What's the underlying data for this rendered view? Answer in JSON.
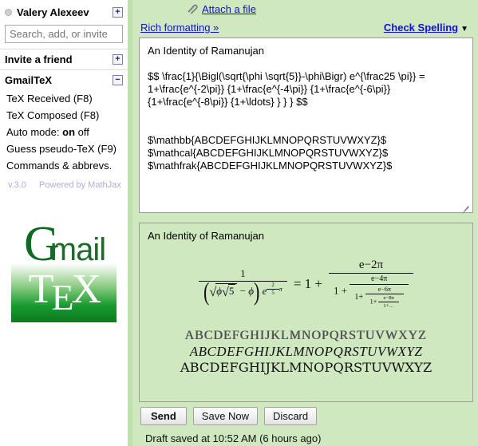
{
  "sidebar": {
    "chat": {
      "user_name": "Valery Alexeev",
      "expand_label": "+",
      "status_icon": "offline-status-icon"
    },
    "search": {
      "placeholder": "Search, add, or invite",
      "value": ""
    },
    "invite": {
      "label": "Invite a friend",
      "expand_label": "+"
    },
    "gmailtex": {
      "title": "GmailTeX",
      "collapse_label": "−",
      "items": [
        {
          "label": "TeX Received (F8)",
          "name": "tex-received"
        },
        {
          "label": "TeX Composed (F8)",
          "name": "tex-composed"
        },
        {
          "label": "Guess pseudo-TeX (F9)",
          "name": "guess-pseudo-tex"
        },
        {
          "label": "Commands & abbrevs.",
          "name": "commands-abbrevs"
        }
      ],
      "auto_mode": {
        "label": "Auto mode:",
        "on": "on",
        "off": "off"
      },
      "version": "v.3.0",
      "powered_by": "Powered by MathJax"
    },
    "logo": {
      "g": "G",
      "mail": "mail",
      "t": "T",
      "e": "E",
      "x": "X"
    }
  },
  "compose": {
    "attach_label": "Attach a file",
    "rich_formatting_label": "Rich formatting »",
    "check_spelling_label": "Check Spelling",
    "check_spelling_caret": "▼",
    "body_value": "An Identity of Ramanujan\n\n$$ \\frac{1}{\\Bigl(\\sqrt{\\phi \\sqrt{5}}-\\phi\\Bigr) e^{\\frac25 \\pi}} =\n1+\\frac{e^{-2\\pi}} {1+\\frac{e^{-4\\pi}} {1+\\frac{e^{-6\\pi}}\n{1+\\frac{e^{-8\\pi}} {1+\\ldots} } } } $$\n\n\n$\\mathbb{ABCDEFGHIJKLMNOPQRSTUVWXYZ}$\n$\\mathcal{ABCDEFGHIJKLMNOPQRSTUVWXYZ}$\n$\\mathfrak{ABCDEFGHIJKLMNOPQRSTUVWXYZ}$",
    "buttons": {
      "send": "Send",
      "save_now": "Save Now",
      "discard": "Discard"
    },
    "draft_status": "Draft saved at 10:52 AM (6 hours ago)"
  },
  "preview": {
    "title": "An Identity of Ramanujan",
    "formula": {
      "lhs_numerator": "1",
      "lhs_den_sqrt_inner": "ϕ",
      "lhs_den_sqrt5": "5",
      "lhs_den_minus_phi": "ϕ",
      "lhs_den_exp_base": "e",
      "lhs_den_exp_num": "2",
      "lhs_den_exp_den": "5",
      "lhs_den_exp_pi": "π",
      "equals": "=",
      "one": "1",
      "plus": "+",
      "cf_levels": [
        "e−2π",
        "e−4π",
        "e−6π",
        "e−8π"
      ],
      "cf_tail": "1+…"
    },
    "alphabets": {
      "mathbb": "ABCDEFGHIJKLMNOPQRSTUVWXYZ",
      "mathcal": "ABCDEFGHIJKLMNOPQRSTUVWXYZ",
      "mathfrak": "ABCDEFGHIJKLMNOPQRSTUVWXYZ"
    }
  }
}
